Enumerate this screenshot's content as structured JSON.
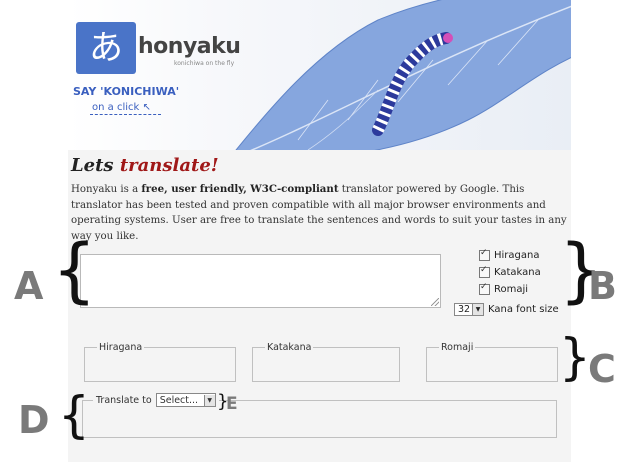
{
  "banner": {
    "logo_glyph": "あ",
    "brand": "honyaku",
    "brand_sub": "konichiwa on the fly",
    "tagline": "SAY 'KONICHIWA'",
    "on_click": "on a click",
    "colors": {
      "brand_blue": "#4a74c8",
      "leaf": "#7fa0dc"
    }
  },
  "heading": {
    "part1": "Lets ",
    "part2": "translate!"
  },
  "intro": {
    "p1": "Honyaku is a ",
    "bold1": "free, user friendly, W3C-compliant",
    "p2": " translator powered by Google. This translator has been tested and proven compatible with all major browser environments and operating systems. User are free to translate the sentences and words to suit your tastes in any way you like."
  },
  "options": {
    "hiragana": "Hiragana",
    "katakana": "Katakana",
    "romaji": "Romaji",
    "font_size_value": "32",
    "font_size_label": "Kana font size"
  },
  "outputs": {
    "hiragana": "Hiragana",
    "katakana": "Katakana",
    "romaji": "Romaji"
  },
  "translate": {
    "label": "Translate to",
    "select_value": "Select..."
  },
  "annotations": {
    "a": "A",
    "b": "B",
    "c": "C",
    "d": "D",
    "e": "E"
  }
}
